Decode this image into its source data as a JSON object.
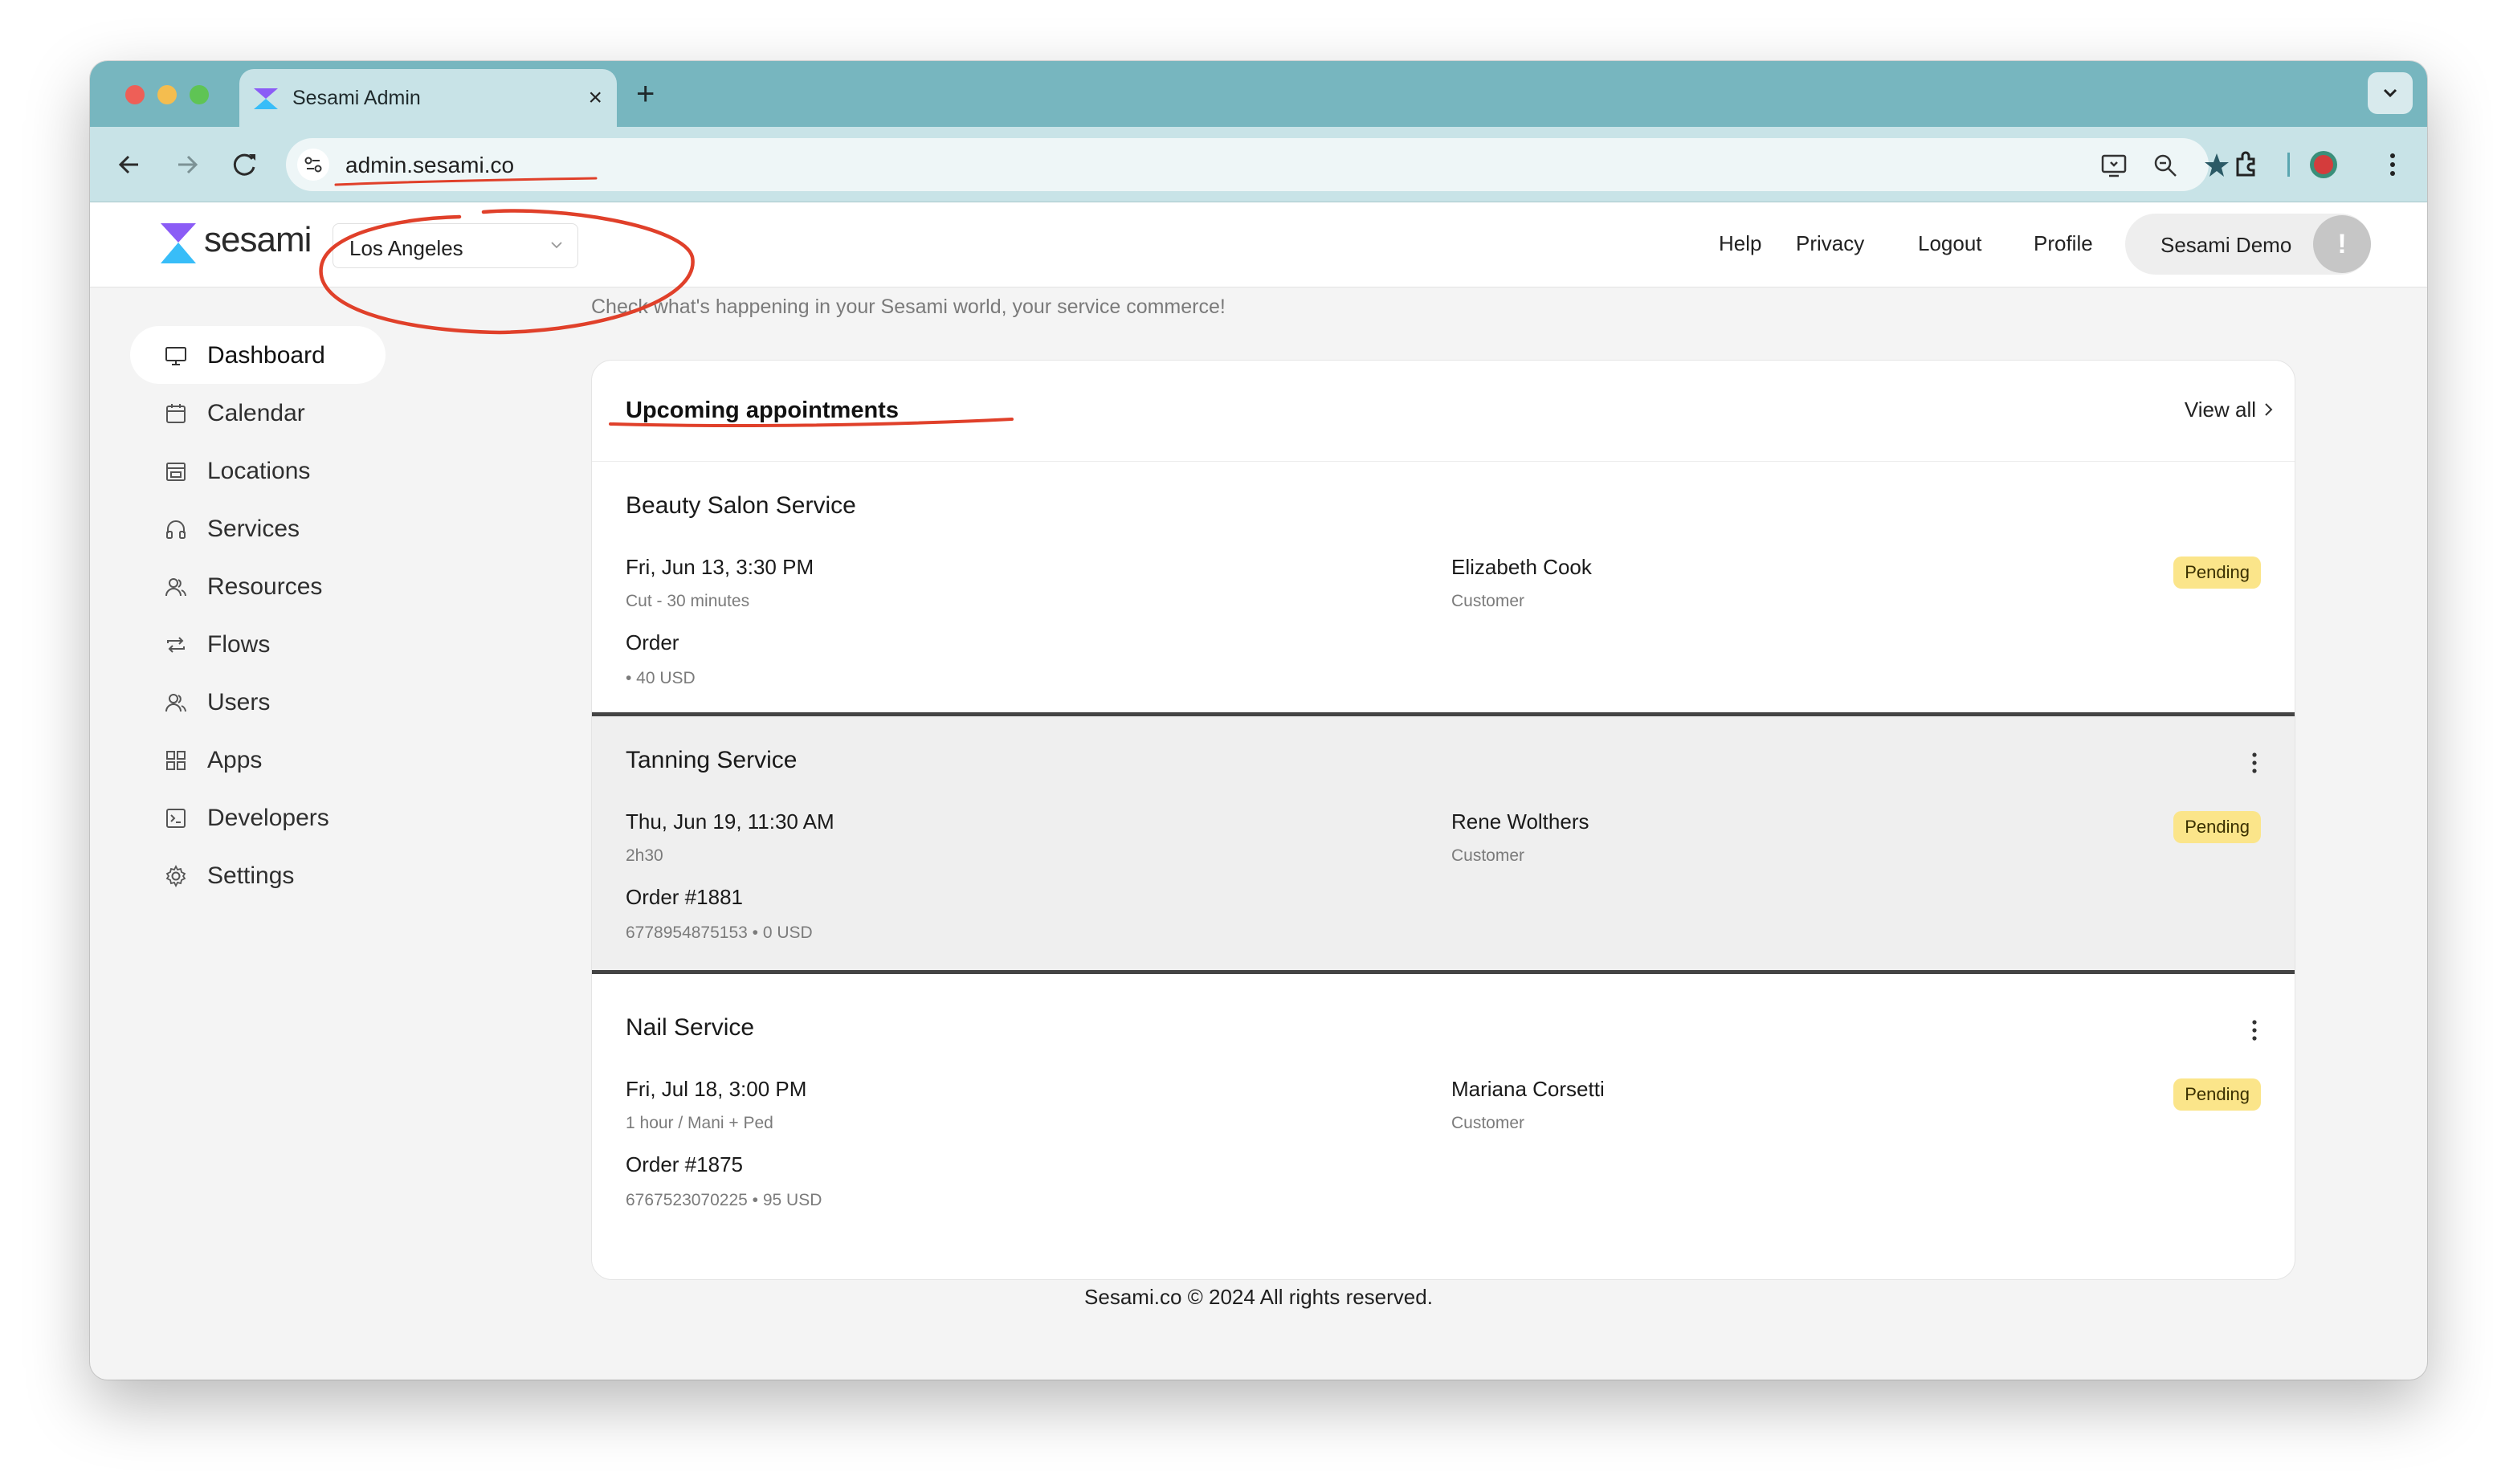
{
  "browser": {
    "tab_title": "Sesami Admin",
    "tab_close": "×",
    "new_tab": "+",
    "url": "admin.sesami.co"
  },
  "header": {
    "logo_text": "sesami",
    "location_select": {
      "value": "Los Angeles"
    },
    "links": {
      "help": "Help",
      "privacy": "Privacy",
      "logout": "Logout",
      "profile": "Profile"
    },
    "user": {
      "name": "Sesami Demo",
      "avatar": "!"
    }
  },
  "sidebar": {
    "items": [
      {
        "label": "Dashboard",
        "icon": "monitor-icon",
        "active": true
      },
      {
        "label": "Calendar",
        "icon": "calendar-icon"
      },
      {
        "label": "Locations",
        "icon": "store-icon"
      },
      {
        "label": "Services",
        "icon": "headphones-icon"
      },
      {
        "label": "Resources",
        "icon": "people-icon"
      },
      {
        "label": "Flows",
        "icon": "repeat-icon"
      },
      {
        "label": "Users",
        "icon": "users-icon"
      },
      {
        "label": "Apps",
        "icon": "apps-icon"
      },
      {
        "label": "Developers",
        "icon": "terminal-icon"
      },
      {
        "label": "Settings",
        "icon": "gear-icon"
      }
    ]
  },
  "main": {
    "subtitle": "Check what's happening in your Sesami world, your service commerce!",
    "card": {
      "title": "Upcoming appointments",
      "view_all": "View all",
      "appointments": [
        {
          "service": "Beauty Salon Service",
          "time": "Fri, Jun 13, 3:30 PM",
          "detail": "Cut - 30 minutes",
          "order": "Order",
          "order_sub": " • 40 USD",
          "customer": "Elizabeth Cook",
          "role": "Customer",
          "status": "Pending"
        },
        {
          "service": "Tanning Service",
          "time": "Thu, Jun 19, 11:30 AM",
          "detail": "2h30",
          "order": "Order #1881",
          "order_sub": "6778954875153 • 0 USD",
          "customer": "Rene Wolthers",
          "role": "Customer",
          "status": "Pending"
        },
        {
          "service": "Nail Service",
          "time": "Fri, Jul 18, 3:00 PM",
          "detail": "1 hour / Mani + Ped",
          "order": "Order #1875",
          "order_sub": "6767523070225 • 95 USD",
          "customer": "Mariana Corsetti",
          "role": "Customer",
          "status": "Pending"
        }
      ]
    }
  },
  "footer": {
    "text": "Sesami.co © 2024  All rights reserved."
  },
  "colors": {
    "tab_strip": "#77b6bf",
    "toolbar": "#c8e3e7",
    "badge_pending": "#fbe58a",
    "annotation_red": "#e0402a"
  }
}
